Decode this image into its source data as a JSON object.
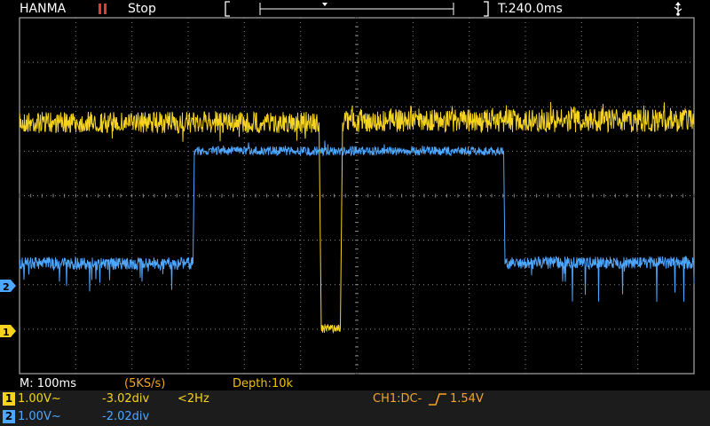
{
  "header": {
    "brand": "HANMA",
    "run_icon": "pause-bars-icon",
    "run_state": "Stop",
    "trigger_time": "T:240.0ms",
    "usb_icon": "usb-icon"
  },
  "colors": {
    "ch1": "#f5d31e",
    "ch2": "#4da6ff",
    "grid": "#8a8a8a",
    "info_orange": "#f5a623",
    "depth_yellow": "#f2c200",
    "ch2_info": "#4da6ff"
  },
  "status": {
    "timebase": "M: 100ms",
    "sample_rate": "(5KS/s)",
    "depth": "Depth:10k"
  },
  "channels": [
    {
      "number": "1",
      "volts": "1.00V",
      "coupling_glyph": "~",
      "offset": "-3.02div",
      "freq": "<2Hz"
    },
    {
      "number": "2",
      "volts": "1.00V",
      "coupling_glyph": "~",
      "offset": "-2.02div",
      "freq": ""
    }
  ],
  "trigger": {
    "source_info": "CH1:DC-",
    "edge_icon": "rising-edge-icon",
    "level": "1.54V"
  },
  "markers": {
    "ch1_label": "1",
    "ch2_label": "2"
  }
}
